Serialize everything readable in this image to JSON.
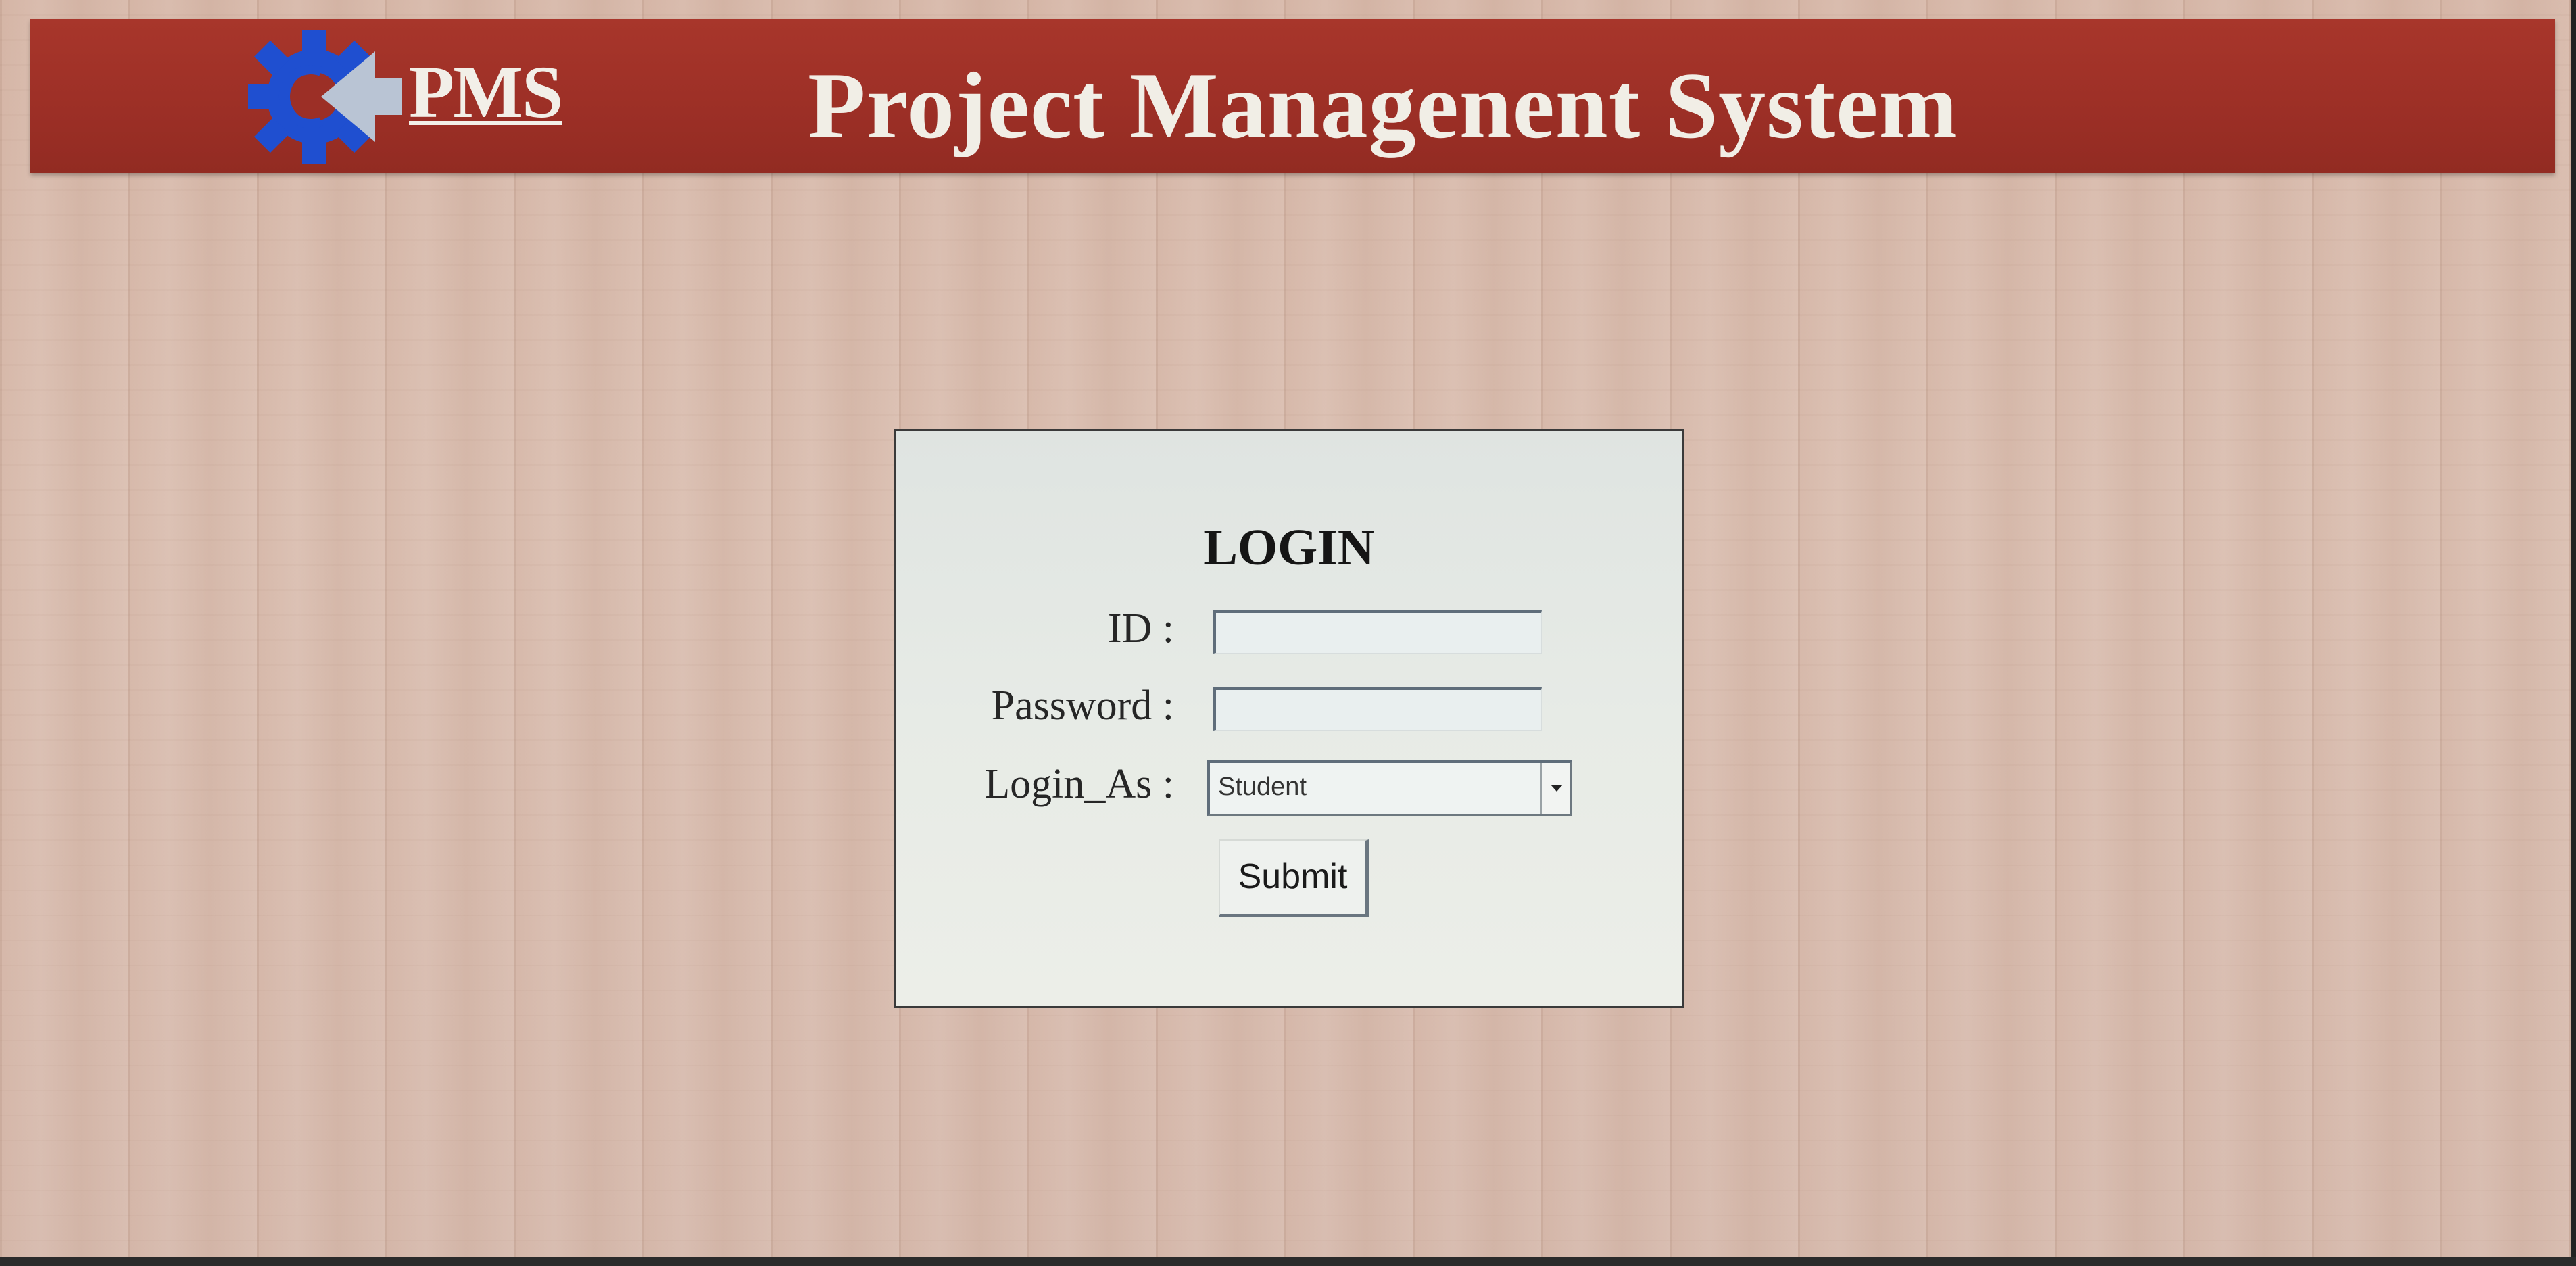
{
  "header": {
    "logo_text": "PMS",
    "title": "Project Managenent System",
    "color": "#9c2f26",
    "logo_gear_color": "#1f4fd0",
    "logo_arrow_color": "#b9c4d4"
  },
  "login": {
    "heading": "LOGIN",
    "id_label": "ID :",
    "id_value": "",
    "password_label": "Password :",
    "password_value": "",
    "login_as_label": "Login_As :",
    "login_as_selected": "Student",
    "submit_label": "Submit"
  }
}
